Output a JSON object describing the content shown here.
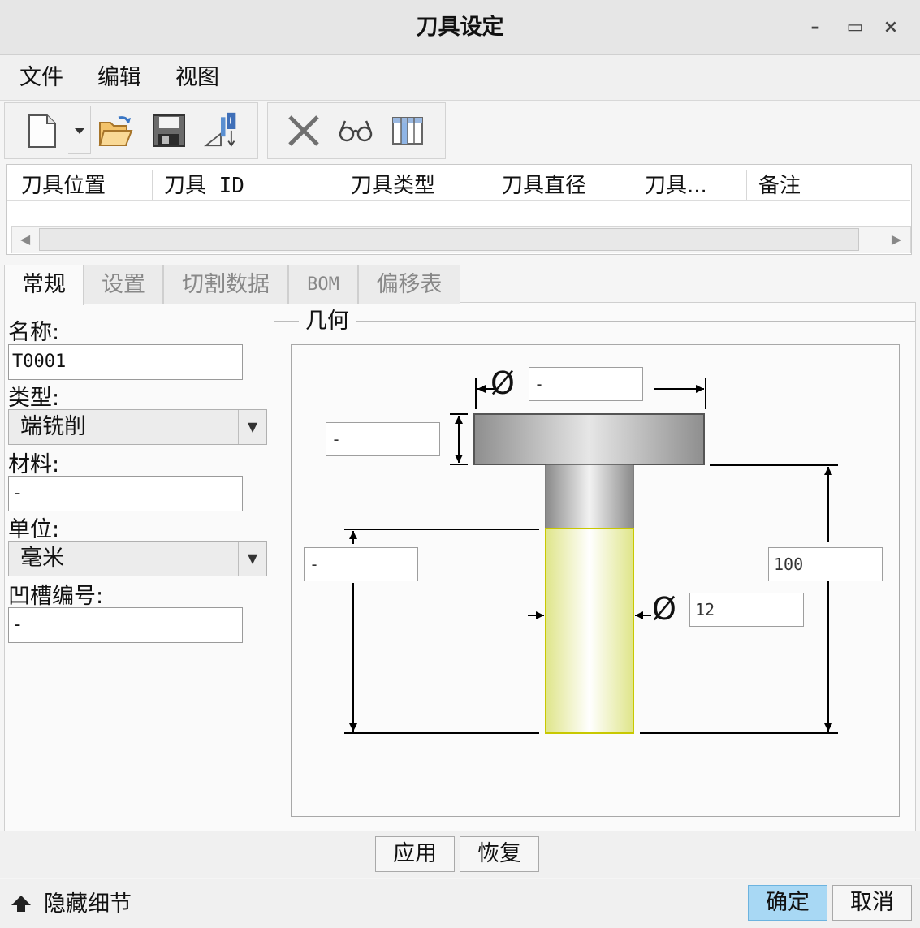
{
  "window": {
    "title": "刀具设定",
    "minimize_glyph": "–",
    "maximize_glyph": "▭",
    "close_glyph": "×"
  },
  "menu": {
    "items": [
      "文件",
      "编辑",
      "视图"
    ]
  },
  "toolbar": {
    "group1": [
      "new-icon",
      "new-dropdown-icon",
      "open-folder-icon",
      "save-icon",
      "measure-tool-icon"
    ],
    "group2": [
      "delete-icon",
      "preview-glasses-icon",
      "columns-icon"
    ]
  },
  "tool_table": {
    "columns": [
      "刀具位置",
      "刀具 ID",
      "刀具类型",
      "刀具直径",
      "刀具...",
      "备注"
    ],
    "rows": []
  },
  "tabs": [
    "常规",
    "设置",
    "切割数据",
    "BOM",
    "偏移表"
  ],
  "active_tab": "常规",
  "form": {
    "name_label": "名称:",
    "name_value": "T0001",
    "type_label": "类型:",
    "type_value": "端铣削",
    "material_label": "材料:",
    "material_value": "-",
    "unit_label": "单位:",
    "unit_value": "毫米",
    "notch_label": "凹槽编号:",
    "notch_value": "-"
  },
  "geometry": {
    "group_label": "几何",
    "diameter_symbol": "Ø",
    "holder_diameter": "-",
    "holder_length": "-",
    "cutting_length": "-",
    "overall_length": "100",
    "cutter_diameter": "12",
    "colors": {
      "holder": "#b5b5b5",
      "shank": "#c8c8c8",
      "flute": "#f6f8c0",
      "flute_outline": "#c8c800",
      "dimension_line": "#000000"
    }
  },
  "actions": {
    "apply": "应用",
    "restore": "恢复"
  },
  "footer": {
    "hide_details": "隐藏细节",
    "ok": "确定",
    "cancel": "取消"
  }
}
